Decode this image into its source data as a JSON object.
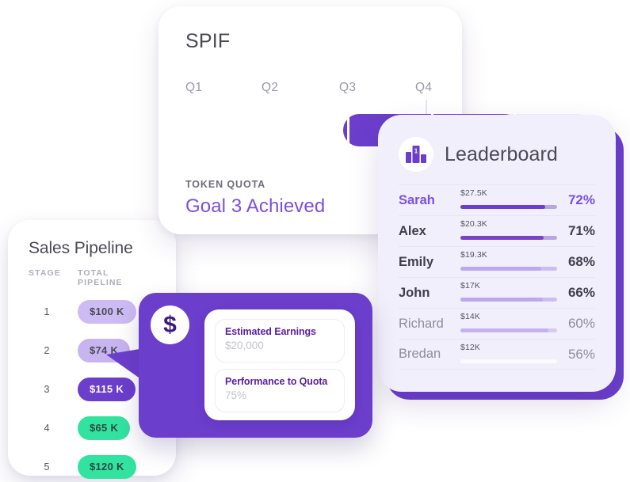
{
  "spif": {
    "title": "SPIF",
    "quarters": [
      "Q1",
      "Q2",
      "Q3",
      "Q4"
    ],
    "quota_label": "TOKEN QUOTA",
    "goal_text": "Goal 3 Achieved",
    "progress_percent": 71,
    "accent_color": "#6b3ecc",
    "goal_color": "#7b4fe0",
    "track_color": "#f0edfb"
  },
  "leaderboard": {
    "title": "Leaderboard",
    "icon": "podium-rank-icon",
    "rank_badge": "1",
    "card_color": "#f2effc",
    "shadow_color": "#6b3ecc",
    "rows": [
      {
        "name": "Sarah",
        "amount": "$27.5K",
        "percent": "72%",
        "value": 72,
        "bar_fill": 88,
        "name_color": "#7b4fe0",
        "pct_color": "#7b4fe0",
        "bar_color": "#6b3ecc",
        "track_color": "#b9a4ea",
        "name_weight": "700"
      },
      {
        "name": "Alex",
        "amount": "$20.3K",
        "percent": "71%",
        "value": 71,
        "bar_fill": 86,
        "name_color": "#3f3f4c",
        "pct_color": "#3f3f4c",
        "bar_color": "#7a42c9",
        "track_color": "#b9a4ea",
        "name_weight": "700"
      },
      {
        "name": "Emily",
        "amount": "$19.3K",
        "percent": "68%",
        "value": 68,
        "bar_fill": 84,
        "name_color": "#3f3f4c",
        "pct_color": "#3f3f4c",
        "bar_color": "#bda7ed",
        "track_color": "#cdbcf3",
        "name_weight": "700"
      },
      {
        "name": "John",
        "amount": "$17K",
        "percent": "66%",
        "value": 66,
        "bar_fill": 85,
        "name_color": "#3f3f4c",
        "pct_color": "#3f3f4c",
        "bar_color": "#bda7ed",
        "track_color": "#cdbcf3",
        "name_weight": "700"
      },
      {
        "name": "Richard",
        "amount": "$14K",
        "percent": "60%",
        "value": 60,
        "bar_fill": 91,
        "name_color": "#8d8d99",
        "pct_color": "#8d8d99",
        "bar_color": "#c5b1f0",
        "track_color": "#d6c9f6",
        "name_weight": "400"
      },
      {
        "name": "Bredan",
        "amount": "$12K",
        "percent": "56%",
        "value": 56,
        "bar_fill": 95,
        "name_color": "#8d8d99",
        "pct_color": "#8d8d99",
        "bar_color": "#fbfaff",
        "track_color": "#fbfaff",
        "name_weight": "400"
      }
    ]
  },
  "pipeline": {
    "title": "Sales Pipeline",
    "header_stage": "STAGE",
    "header_total": "TOTAL PIPELINE",
    "rows": [
      {
        "stage": "1",
        "amount": "$100 K",
        "bg": "#cdbcf3",
        "fg": "#4a4a55"
      },
      {
        "stage": "2",
        "amount": "$74 K",
        "bg": "#c7b4f0",
        "fg": "#4a4a55"
      },
      {
        "stage": "3",
        "amount": "$115 K",
        "bg": "#6b3ecc",
        "fg": "#ffffff"
      },
      {
        "stage": "4",
        "amount": "$65 K",
        "bg": "#32e3a0",
        "fg": "#2b4a42"
      },
      {
        "stage": "5",
        "amount": "$120 K",
        "bg": "#32e3a0",
        "fg": "#2b4a42"
      }
    ]
  },
  "earnings": {
    "icon": "dollar-sign-icon",
    "dollar_glyph": "$",
    "fields": [
      {
        "label": "Estimated Earnings",
        "value": "$20,000"
      },
      {
        "label": "Performance to Quota",
        "value": "75%"
      }
    ],
    "card_color": "#6b3ecc"
  }
}
